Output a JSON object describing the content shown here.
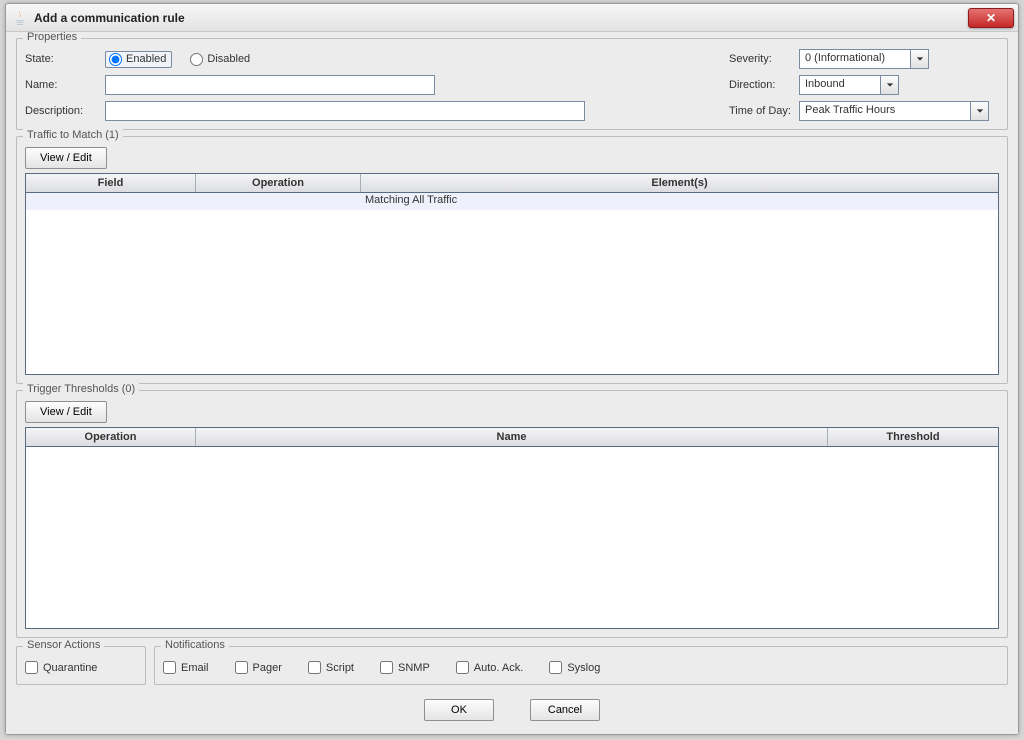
{
  "window": {
    "title": "Add a communication rule"
  },
  "properties": {
    "legend": "Properties",
    "state_label": "State:",
    "enabled_label": "Enabled",
    "disabled_label": "Disabled",
    "name_label": "Name:",
    "name_value": "",
    "desc_label": "Description:",
    "desc_value": "",
    "severity_label": "Severity:",
    "severity_value": "0 (Informational)",
    "direction_label": "Direction:",
    "direction_value": "Inbound",
    "tod_label": "Time of Day:",
    "tod_value": "Peak Traffic Hours"
  },
  "traffic": {
    "legend": "Traffic to Match (1)",
    "view_edit": "View / Edit",
    "columns": {
      "field": "Field",
      "operation": "Operation",
      "elements": "Element(s)"
    },
    "rows": [
      {
        "field": "",
        "operation": "",
        "elements": "Matching All Traffic"
      }
    ]
  },
  "trigger": {
    "legend": "Trigger Thresholds (0)",
    "view_edit": "View / Edit",
    "columns": {
      "operation": "Operation",
      "name": "Name",
      "threshold": "Threshold"
    },
    "rows": []
  },
  "sensor": {
    "legend": "Sensor Actions",
    "quarantine": "Quarantine"
  },
  "notifications": {
    "legend": "Notifications",
    "email": "Email",
    "pager": "Pager",
    "script": "Script",
    "snmp": "SNMP",
    "autoack": "Auto. Ack.",
    "syslog": "Syslog"
  },
  "buttons": {
    "ok": "OK",
    "cancel": "Cancel"
  }
}
